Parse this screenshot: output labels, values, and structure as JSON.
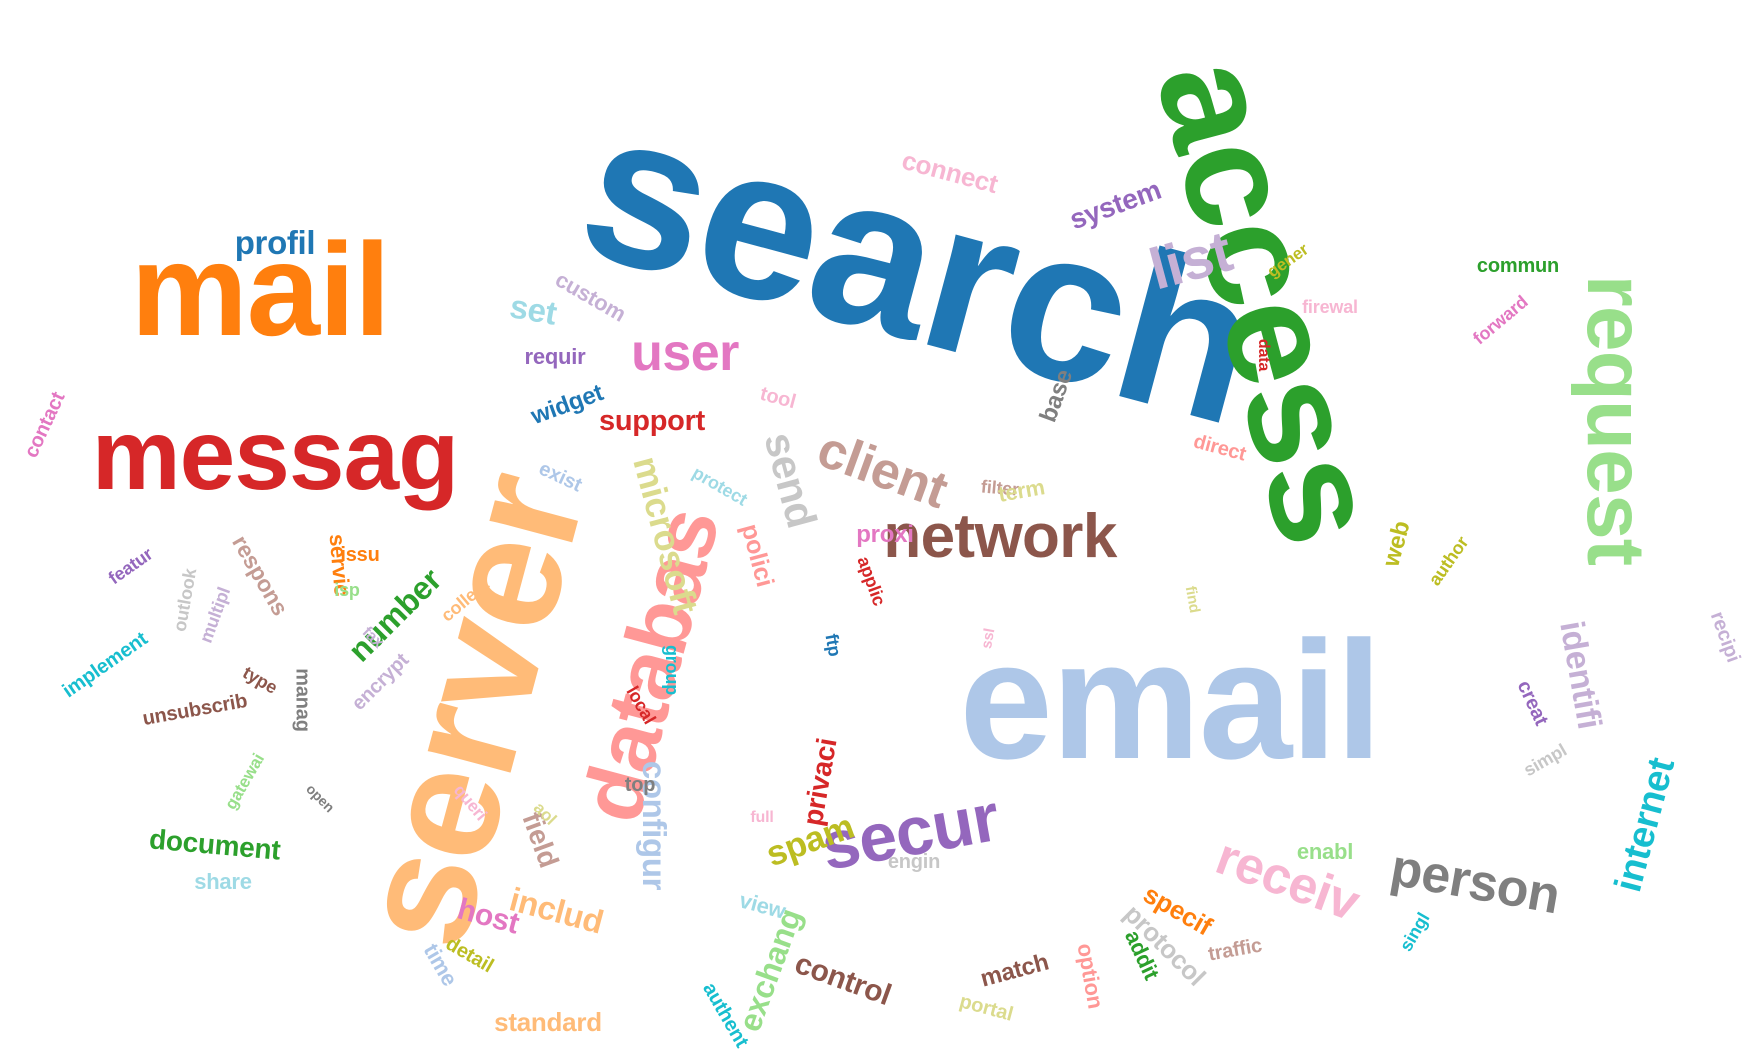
{
  "words": [
    {
      "text": "search",
      "color": "#1f77b4",
      "rot": 15
    },
    {
      "text": "email",
      "color": "#aec7e8",
      "rot": 0
    },
    {
      "text": "server",
      "color": "#ffbb78",
      "rot": -75
    },
    {
      "text": "access",
      "color": "#2ca02c",
      "rot": 75
    },
    {
      "text": "mail",
      "color": "#ff7f0e",
      "rot": 0
    },
    {
      "text": "messag",
      "color": "#d62728",
      "rot": 0
    },
    {
      "text": "request",
      "color": "#98df8a",
      "rot": 90
    },
    {
      "text": "databas",
      "color": "#ff9896",
      "rot": -75
    },
    {
      "text": "network",
      "color": "#8c564b",
      "rot": 0
    },
    {
      "text": "secur",
      "color": "#9467bd",
      "rot": -10
    },
    {
      "text": "person",
      "color": "#7f7f7f",
      "rot": 10
    },
    {
      "text": "client",
      "color": "#c49c94",
      "rot": 20
    },
    {
      "text": "list",
      "color": "#c5b0d5",
      "rot": -15
    },
    {
      "text": "user",
      "color": "#e377c2",
      "rot": 0
    },
    {
      "text": "microsoft",
      "color": "#dbdb8d",
      "rot": 75
    },
    {
      "text": "receiv",
      "color": "#f7b6d2",
      "rot": 20
    },
    {
      "text": "send",
      "color": "#c7c7c7",
      "rot": 75
    },
    {
      "text": "internet",
      "color": "#17becf",
      "rot": -75
    },
    {
      "text": "profil",
      "color": "#1f77b4",
      "rot": 0
    },
    {
      "text": "identifi",
      "color": "#c5b0d5",
      "rot": 80
    },
    {
      "text": "spam",
      "color": "#bcbd22",
      "rot": -20
    },
    {
      "text": "includ",
      "color": "#ffbb78",
      "rot": 15
    },
    {
      "text": "configur",
      "color": "#aec7e8",
      "rot": 90
    },
    {
      "text": "support",
      "color": "#d62728",
      "rot": 0
    },
    {
      "text": "number",
      "color": "#2ca02c",
      "rot": -45
    },
    {
      "text": "control",
      "color": "#8c564b",
      "rot": 20
    },
    {
      "text": "document",
      "color": "#2ca02c",
      "rot": 5
    },
    {
      "text": "exchang",
      "color": "#98df8a",
      "rot": -70
    },
    {
      "text": "connect",
      "color": "#f7b6d2",
      "rot": 15
    },
    {
      "text": "system",
      "color": "#9467bd",
      "rot": -20
    },
    {
      "text": "host",
      "color": "#e377c2",
      "rot": 15
    },
    {
      "text": "set",
      "color": "#9edae5",
      "rot": 10
    },
    {
      "text": "base",
      "color": "#7f7f7f",
      "rot": -70
    },
    {
      "text": "protocol",
      "color": "#c7c7c7",
      "rot": 45
    },
    {
      "text": "specif",
      "color": "#ff7f0e",
      "rot": 30
    },
    {
      "text": "field",
      "color": "#c49c94",
      "rot": 70
    },
    {
      "text": "privaci",
      "color": "#d62728",
      "rot": -80
    },
    {
      "text": "polici",
      "color": "#ff9896",
      "rot": 75
    },
    {
      "text": "widget",
      "color": "#1f77b4",
      "rot": -20
    },
    {
      "text": "custom",
      "color": "#c5b0d5",
      "rot": 30
    },
    {
      "text": "respons",
      "color": "#c49c94",
      "rot": 60
    },
    {
      "text": "servic",
      "color": "#ff7f0e",
      "rot": 85
    },
    {
      "text": "standard",
      "color": "#ffbb78",
      "rot": 0
    },
    {
      "text": "match",
      "color": "#8c564b",
      "rot": -15
    },
    {
      "text": "proxi",
      "color": "#e377c2",
      "rot": 0
    },
    {
      "text": "tool",
      "color": "#f7b6d2",
      "rot": 15
    },
    {
      "text": "requir",
      "color": "#9467bd",
      "rot": 0
    },
    {
      "text": "contact",
      "color": "#e377c2",
      "rot": -65
    },
    {
      "text": "filter",
      "color": "#c49c94",
      "rot": 5
    },
    {
      "text": "commun",
      "color": "#2ca02c",
      "rot": 0
    },
    {
      "text": "forward",
      "color": "#e377c2",
      "rot": -40
    },
    {
      "text": "firewal",
      "color": "#f7b6d2",
      "rot": 0
    },
    {
      "text": "data",
      "color": "#d62728",
      "rot": 90
    },
    {
      "text": "direct",
      "color": "#ff9896",
      "rot": 15
    },
    {
      "text": "term",
      "color": "#dbdb8d",
      "rot": -10
    },
    {
      "text": "web",
      "color": "#bcbd22",
      "rot": -75
    },
    {
      "text": "author",
      "color": "#bcbd22",
      "rot": -55
    },
    {
      "text": "gener",
      "color": "#bcbd22",
      "rot": -35
    },
    {
      "text": "recipi",
      "color": "#c5b0d5",
      "rot": 70
    },
    {
      "text": "creat",
      "color": "#9467bd",
      "rot": 65
    },
    {
      "text": "simpl",
      "color": "#c7c7c7",
      "rot": -30
    },
    {
      "text": "singl",
      "color": "#17becf",
      "rot": -60
    },
    {
      "text": "traffic",
      "color": "#c49c94",
      "rot": -10
    },
    {
      "text": "enabl",
      "color": "#98df8a",
      "rot": 0
    },
    {
      "text": "engin",
      "color": "#c7c7c7",
      "rot": 0
    },
    {
      "text": "view",
      "color": "#9edae5",
      "rot": 15
    },
    {
      "text": "option",
      "color": "#ff9896",
      "rot": 80
    },
    {
      "text": "addit",
      "color": "#2ca02c",
      "rot": 65
    },
    {
      "text": "portal",
      "color": "#dbdb8d",
      "rot": 15
    },
    {
      "text": "authent",
      "color": "#17becf",
      "rot": 60
    },
    {
      "text": "applic",
      "color": "#d62728",
      "rot": 70
    },
    {
      "text": "ftp",
      "color": "#1f77b4",
      "rot": 80
    },
    {
      "text": "find",
      "color": "#dbdb8d",
      "rot": 80
    },
    {
      "text": "ssl",
      "color": "#f7b6d2",
      "rot": -80
    },
    {
      "text": "group",
      "color": "#17becf",
      "rot": 90
    },
    {
      "text": "local",
      "color": "#d62728",
      "rot": 60
    },
    {
      "text": "top",
      "color": "#7f7f7f",
      "rot": 0
    },
    {
      "text": "full",
      "color": "#f7b6d2",
      "rot": 0
    },
    {
      "text": "aol",
      "color": "#dbdb8d",
      "rot": 45
    },
    {
      "text": "queri",
      "color": "#f7b6d2",
      "rot": 50
    },
    {
      "text": "open",
      "color": "#7f7f7f",
      "rot": 45
    },
    {
      "text": "exist",
      "color": "#aec7e8",
      "rot": 25
    },
    {
      "text": "protect",
      "color": "#9edae5",
      "rot": 30
    },
    {
      "text": "issu",
      "color": "#ff7f0e",
      "rot": 0
    },
    {
      "text": "isp",
      "color": "#98df8a",
      "rot": 0
    },
    {
      "text": "collect",
      "color": "#ffbb78",
      "rot": -40
    },
    {
      "text": "fax",
      "color": "#c5b0d5",
      "rot": 45
    },
    {
      "text": "encrypt",
      "color": "#c5b0d5",
      "rot": -45
    },
    {
      "text": "manag",
      "color": "#7f7f7f",
      "rot": 90
    },
    {
      "text": "gatewai",
      "color": "#98df8a",
      "rot": -60
    },
    {
      "text": "type",
      "color": "#8c564b",
      "rot": 30
    },
    {
      "text": "unsubscrib",
      "color": "#8c564b",
      "rot": -10
    },
    {
      "text": "multipl",
      "color": "#c5b0d5",
      "rot": -70
    },
    {
      "text": "outlook",
      "color": "#c7c7c7",
      "rot": -80
    },
    {
      "text": "featur",
      "color": "#9467bd",
      "rot": -35
    },
    {
      "text": "implement",
      "color": "#17becf",
      "rot": -35
    },
    {
      "text": "share",
      "color": "#9edae5",
      "rot": 0
    },
    {
      "text": "time",
      "color": "#aec7e8",
      "rot": 60
    },
    {
      "text": "detail",
      "color": "#bcbd22",
      "rot": 30
    }
  ]
}
